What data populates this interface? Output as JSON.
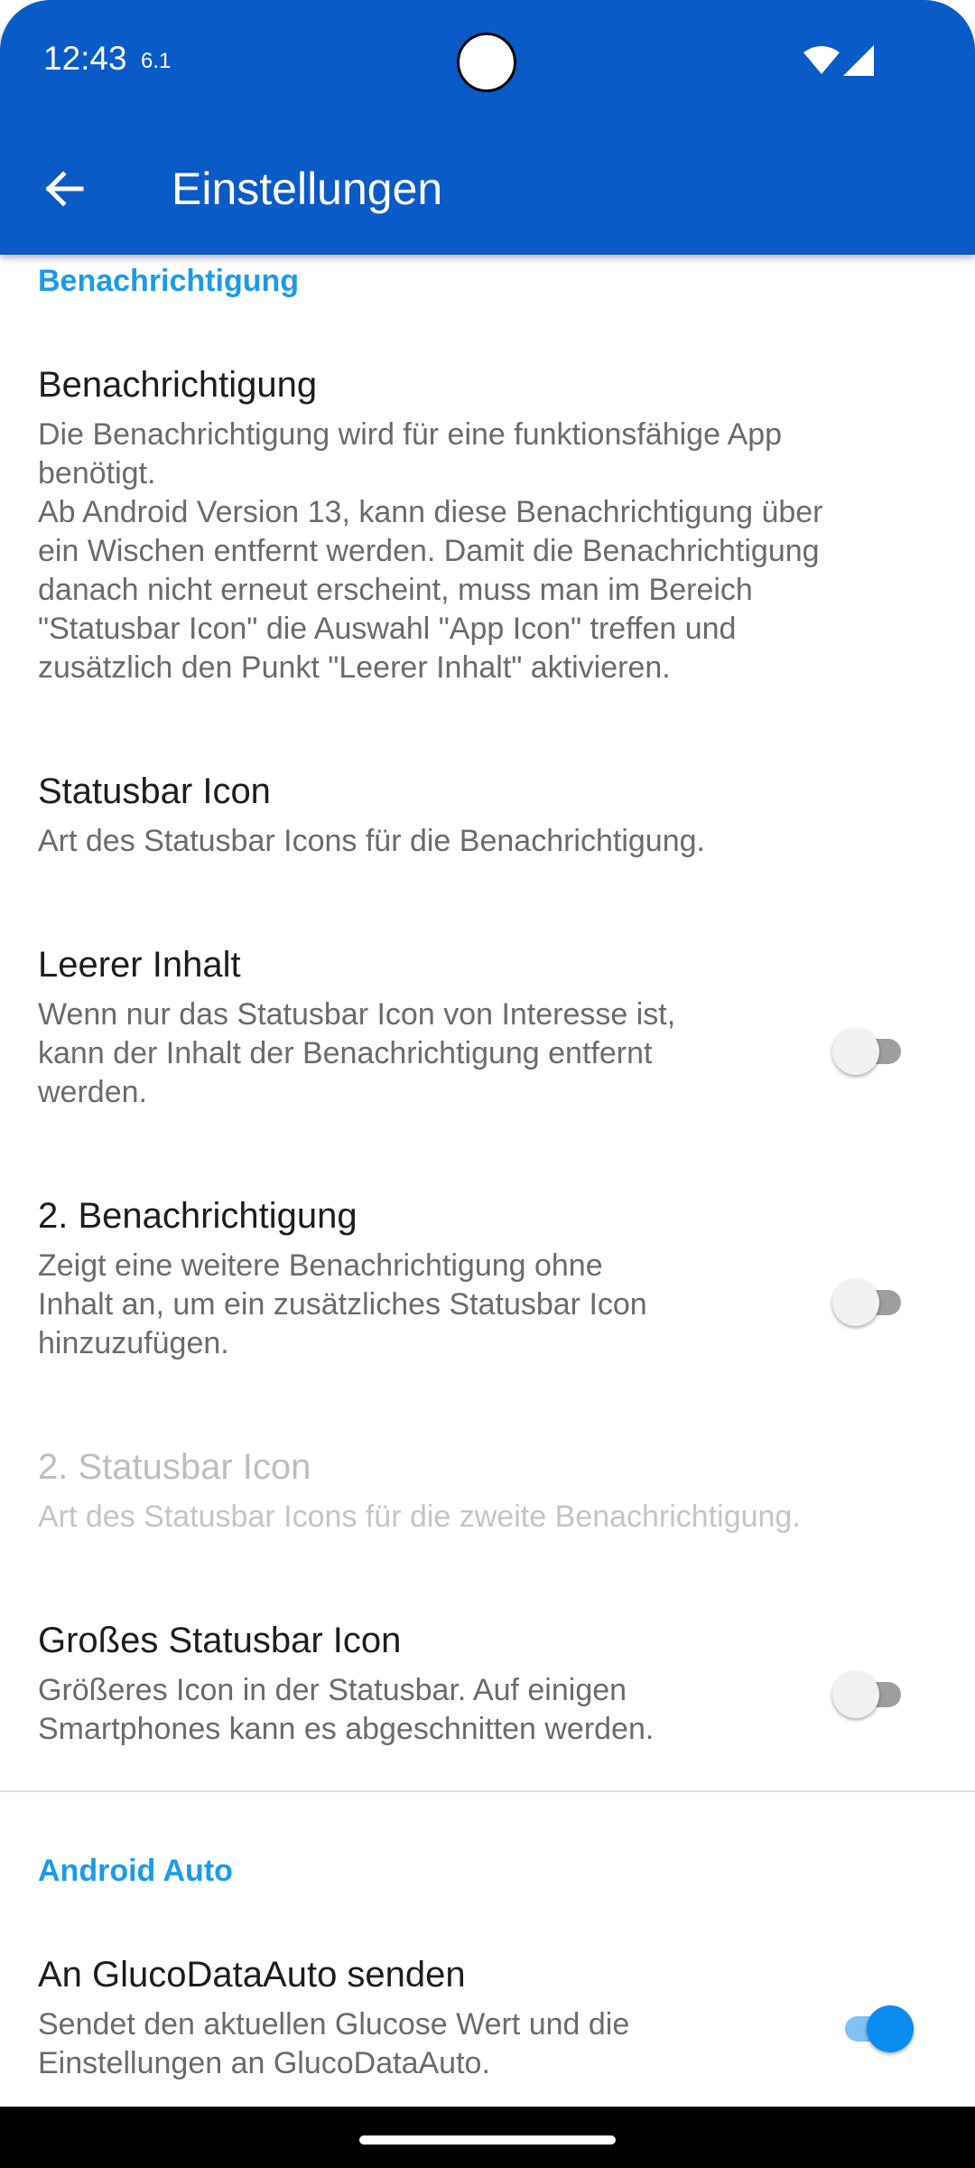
{
  "status_bar": {
    "time": "12:43",
    "extra": "6.1"
  },
  "app_bar": {
    "title": "Einstellungen"
  },
  "sections": {
    "notification": {
      "header": "Benachrichtigung",
      "items": [
        {
          "title": "Benachrichtigung",
          "summary_lines": [
            "Die Benachrichtigung wird für eine funktionsfähige App",
            "benötigt.",
            "Ab Android Version 13, kann diese Benachrichtigung über",
            "ein Wischen entfernt werden. Damit die Benachrichtigung",
            "danach nicht erneut erscheint, muss man im Bereich",
            "\"Statusbar Icon\" die Auswahl \"App Icon\" treffen und",
            "zusätzlich den Punkt \"Leerer Inhalt\" aktivieren."
          ]
        },
        {
          "title": "Statusbar Icon",
          "summary_lines": [
            "Art des Statusbar Icons für die Benachrichtigung."
          ]
        },
        {
          "title": "Leerer Inhalt",
          "summary_lines": [
            "Wenn nur das Statusbar Icon von Interesse ist,",
            "kann der Inhalt der Benachrichtigung entfernt",
            "werden."
          ],
          "switch_on": false
        },
        {
          "title": "2. Benachrichtigung",
          "summary_lines": [
            "Zeigt eine weitere Benachrichtigung ohne",
            "Inhalt an, um ein zusätzliches Statusbar Icon",
            "hinzuzufügen."
          ],
          "switch_on": false
        },
        {
          "title": "2. Statusbar Icon",
          "summary_lines": [
            "Art des Statusbar Icons für die zweite Benachrichtigung."
          ],
          "enabled": false
        },
        {
          "title": "Großes Statusbar Icon",
          "summary_lines": [
            "Größeres Icon in der Statusbar. Auf einigen",
            "Smartphones kann es abgeschnitten werden."
          ],
          "switch_on": false
        }
      ]
    },
    "android_auto": {
      "header": "Android Auto",
      "items": [
        {
          "title": "An GlucoDataAuto senden",
          "summary_lines": [
            "Sendet den aktuellen Glucose Wert und die",
            "Einstellungen an GlucoDataAuto."
          ],
          "switch_on": true
        }
      ]
    }
  },
  "icons": {
    "back": "arrow-back-icon",
    "wifi": "wifi-icon",
    "signal": "cell-signal-icon"
  },
  "colors": {
    "app_bar": "#0a5ac8",
    "section_header": "#1a9be8",
    "switch_on": "#0b8cf0"
  }
}
